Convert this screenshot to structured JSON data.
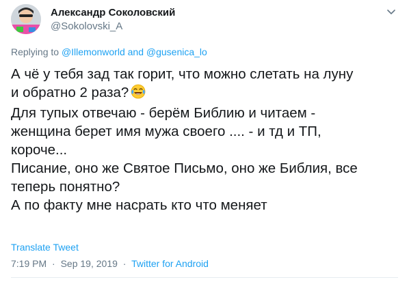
{
  "author": {
    "display_name": "Александр Соколовский",
    "username": "@Sokolovski_A",
    "avatar_icon": "avatar-photo",
    "menu_icon": "chevron-down-icon"
  },
  "reply": {
    "prefix": "Replying to",
    "user1": "@Illemonworld",
    "and": "and",
    "user2": "@gusenica_lo"
  },
  "body": {
    "lines": [
      "А чё у тебя зад так горит, что можно слетать на луну",
      "и обратно 2 раза?",
      "Для тупых отвечаю - берём Библию и читаем -",
      "женщина берет имя мужа своего .... - и тд и ТП,",
      "короче...",
      "Писание, оно же Святое Письмо, оно же Библия, все",
      "теперь понятно?",
      "А по факту мне насрать кто что меняет"
    ],
    "emoji": "face-with-tears-of-joy"
  },
  "translate_label": "Translate Tweet",
  "meta": {
    "time": "7:19 PM",
    "date": "Sep 19, 2019",
    "source": "Twitter for Android",
    "separator": "·"
  },
  "colors": {
    "link": "#1da1f2",
    "secondary_text": "#657786",
    "primary_text": "#14171a"
  }
}
